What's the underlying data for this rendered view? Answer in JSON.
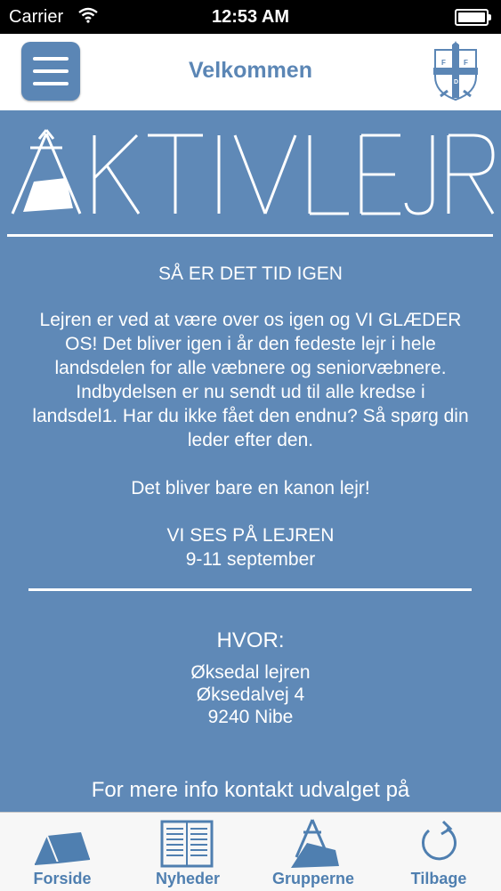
{
  "status_bar": {
    "carrier": "Carrier",
    "time": "12:53 AM"
  },
  "nav": {
    "title": "Velkommen"
  },
  "logo": {
    "letters": "FDF"
  },
  "banner": {
    "text": "ÅKTIVLEJR"
  },
  "content": {
    "heading": "SÅ ER DET TID IGEN",
    "paragraph": "Lejren er ved at være over os igen og VI GLÆDER OS! Det bliver igen i år den fedeste lejr i hele landsdelen for alle væbnere og seniorvæbnere. Indbydelsen er nu sendt ud til alle kredse i landsdel1. Har du ikke fået den endnu? Så spørg din leder efter den.",
    "kanon": "Det bliver bare en kanon lejr!",
    "see_you": "VI SES PÅ LEJREN",
    "dates": "9-11 september",
    "where_heading": "HVOR:",
    "address_line1": "Øksedal lejren",
    "address_line2": "Øksedalvej 4",
    "address_line3": "9240 Nibe",
    "more_info": "For mere info kontakt udvalget på"
  },
  "tabs": [
    {
      "label": "Forside",
      "icon": "tent-icon"
    },
    {
      "label": "Nyheder",
      "icon": "newspaper-icon"
    },
    {
      "label": "Grupperne",
      "icon": "campfire-icon"
    },
    {
      "label": "Tilbage",
      "icon": "refresh-icon"
    }
  ],
  "colors": {
    "accent": "#5b86b5",
    "background": "#5f89b7",
    "tab_label": "#4f7fb0"
  }
}
